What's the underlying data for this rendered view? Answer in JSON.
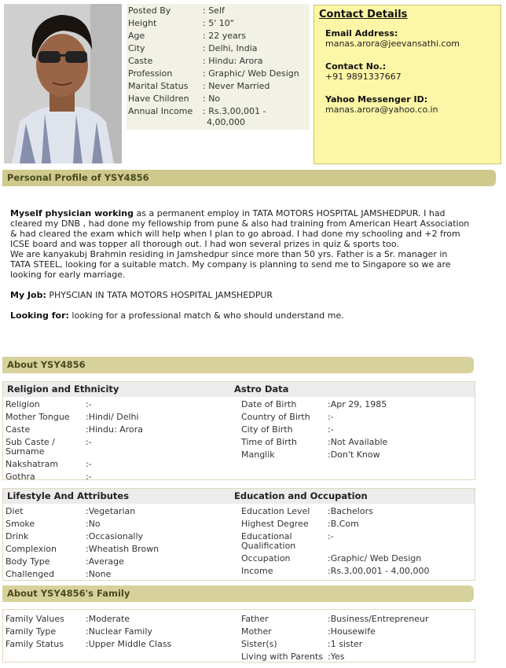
{
  "basic": {
    "rows": [
      {
        "k": "Posted By",
        "v": ": Self"
      },
      {
        "k": "Height",
        "v": ": 5' 10\""
      },
      {
        "k": "Age",
        "v": ": 22 years"
      },
      {
        "k": "City",
        "v": ": Delhi, India"
      },
      {
        "k": "Caste",
        "v": ": Hindu: Arora"
      },
      {
        "k": "Profession",
        "v": ": Graphic/ Web Design"
      },
      {
        "k": "Marital Status",
        "v": ": Never Married"
      },
      {
        "k": "Have Children",
        "v": ": No"
      },
      {
        "k": "Annual Income",
        "v": ": Rs.3,00,001 -"
      },
      {
        "k": "",
        "v": "4,00,000"
      }
    ]
  },
  "contact": {
    "title": "Contact Details",
    "email_label": "Email Address:",
    "email": "manas.arora@jeevansathi.com",
    "phone_label": "Contact No.:",
    "phone": "+91 9891337667",
    "yahoo_label": "Yahoo Messenger ID:",
    "yahoo": "manas.arora@yahoo.co.in"
  },
  "sections": {
    "personal": "Personal Profile of YSY4856",
    "about": "About YSY4856",
    "family": "About YSY4856's Family"
  },
  "profile": {
    "lead": "Myself physician working",
    "line1": " as a permanent employ in TATA MOTORS HOSPITAL JAMSHEDPUR. I had",
    "line2": "cleared my DNB , had done my fellowship from pune & also had training from American Heart Association",
    "line3": "& had cleared the exam which will help when I plan to go abroad. I had done my schooling and +2 from",
    "line4": "ICSE board and was topper all thorough out. I had won several prizes in quiz & sports too.",
    "line5": "We are kanyakubj Brahmin residing in Jamshedpur since more than 50 yrs. Father is a Sr. manager in",
    "line6": "TATA STEEL, looking for a suitable match. My company is planning to send me to Singapore so we are",
    "line7": "looking for early marriage.",
    "job_label": "My Job:",
    "job": " PHYSCIAN IN TATA MOTORS HOSPITAL JAMSHEDPUR",
    "looking_label": "Looking for:",
    "looking": " looking for a professional match & who should understand me."
  },
  "religion": {
    "title": "Religion and Ethnicity",
    "rows": [
      {
        "k": "Religion",
        "v": ":-"
      },
      {
        "k": "Mother Tongue",
        "v": ":Hindi/ Delhi"
      },
      {
        "k": "Caste",
        "v": ":Hindu: Arora"
      },
      {
        "k": "Sub Caste / Surname",
        "v": ":-"
      },
      {
        "k": "Nakshatram",
        "v": ":-"
      },
      {
        "k": "Gothra",
        "v": ":-"
      }
    ]
  },
  "astro": {
    "title": "Astro Data",
    "rows": [
      {
        "k": "Date of Birth",
        "v": ":Apr 29, 1985"
      },
      {
        "k": "Country of Birth",
        "v": ":-"
      },
      {
        "k": "City of Birth",
        "v": ":-"
      },
      {
        "k": "Time of Birth",
        "v": ":Not Available"
      },
      {
        "k": "Manglik",
        "v": ":Don't Know"
      }
    ]
  },
  "lifestyle": {
    "title": "Lifestyle And Attributes",
    "rows": [
      {
        "k": "Diet",
        "v": ":Vegetarian"
      },
      {
        "k": "Smoke",
        "v": ":No"
      },
      {
        "k": "Drink",
        "v": ":Occasionally"
      },
      {
        "k": "Complexion",
        "v": ":Wheatish Brown"
      },
      {
        "k": "Body Type",
        "v": ":Average"
      },
      {
        "k": "Challenged",
        "v": ":None"
      }
    ]
  },
  "education": {
    "title": "Education and Occupation",
    "rows": [
      {
        "k": "Education Level",
        "v": ":Bachelors"
      },
      {
        "k": "Highest Degree",
        "v": ":B.Com"
      },
      {
        "k": "Educational Qualification",
        "v": ":-"
      },
      {
        "k": "Occupation",
        "v": ":Graphic/ Web Design"
      },
      {
        "k": "Income",
        "v": ":Rs.3,00,001 - 4,00,000"
      }
    ]
  },
  "family_left": {
    "rows": [
      {
        "k": "Family Values",
        "v": ":Moderate"
      },
      {
        "k": "Family Type",
        "v": ":Nuclear Family"
      },
      {
        "k": "Family Status",
        "v": ":Upper Middle Class"
      }
    ]
  },
  "family_right": {
    "rows": [
      {
        "k": "Father",
        "v": ":Business/Entrepreneur"
      },
      {
        "k": "Mother",
        "v": ":Housewife"
      },
      {
        "k": "Sister(s)",
        "v": ":1 sister"
      },
      {
        "k": "Living with Parents",
        "v": ":Yes"
      }
    ]
  }
}
